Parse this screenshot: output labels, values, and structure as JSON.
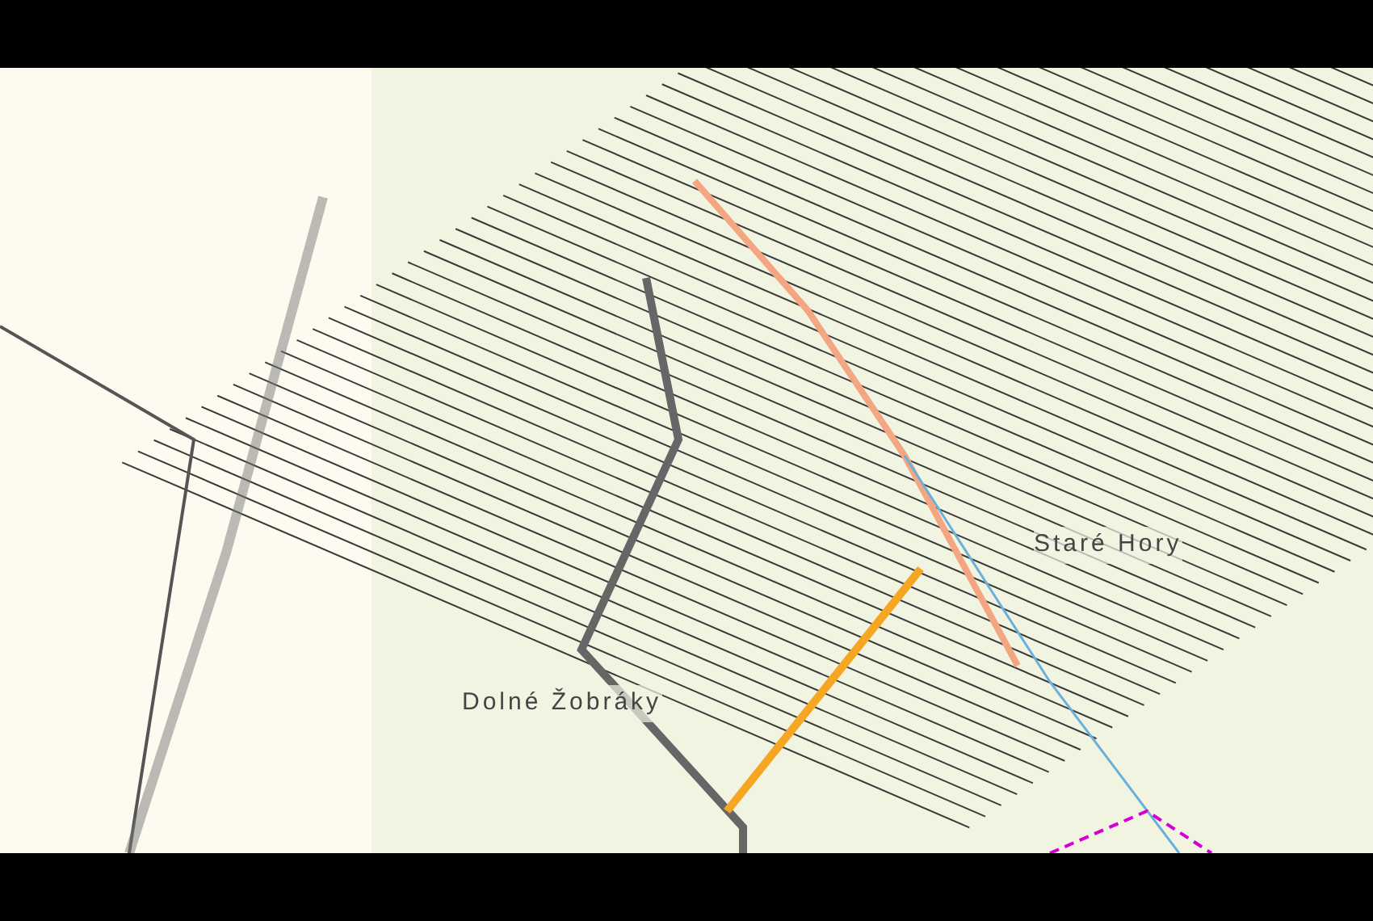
{
  "map": {
    "labels": [
      {
        "text": "Dolné Žobráky"
      },
      {
        "text": "Staré Hory"
      }
    ]
  }
}
